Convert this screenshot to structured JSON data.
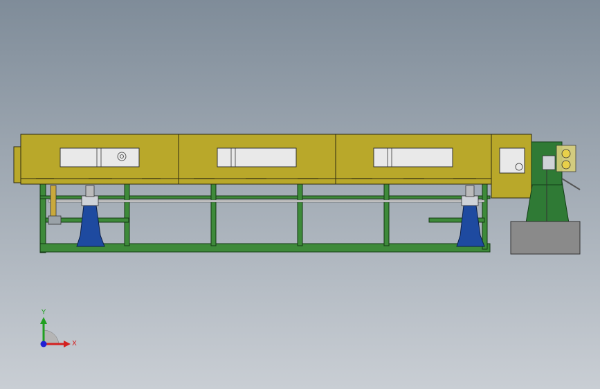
{
  "viewport": {
    "background_top": "#7f8c99",
    "background_bottom": "#c9ced4"
  },
  "colors": {
    "housing": "#b9a82a",
    "housing_edge": "#2d2a10",
    "window": "#e9e9e9",
    "frame": "#3e8a3a",
    "frame_edge": "#133812",
    "support": "#1e4aa0",
    "support_edge": "#0c1f45",
    "base_block": "#8a8a8a",
    "machine": "#2f7a35"
  },
  "triad": {
    "x_label": "X",
    "y_label": "Y",
    "x_color": "#d42020",
    "y_color": "#20a020",
    "z_color": "#2020d4"
  }
}
